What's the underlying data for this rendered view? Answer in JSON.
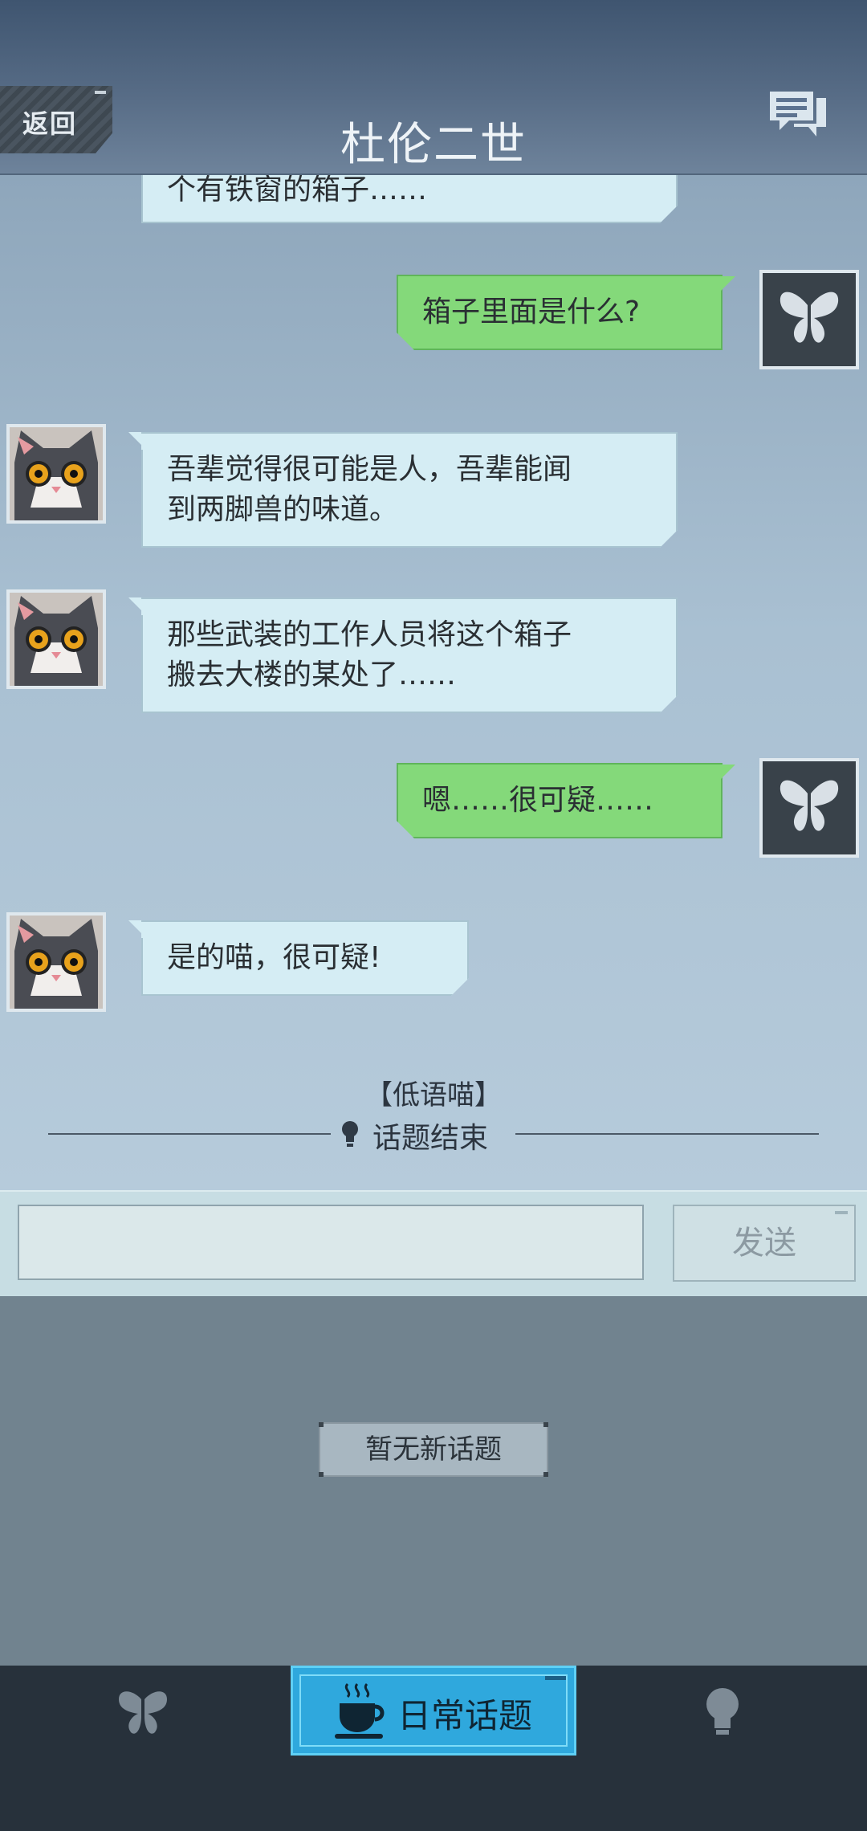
{
  "header": {
    "back_label": "返回",
    "title": "杜伦二世",
    "icons": [
      "back-button",
      "messages-icon"
    ]
  },
  "chat": {
    "messages": [
      {
        "side": "left",
        "sender": "cat",
        "text_lines": [
          "个有铁窗的箱子……"
        ]
      },
      {
        "side": "right",
        "sender": "player",
        "text_lines": [
          "箱子里面是什么?"
        ]
      },
      {
        "side": "left",
        "sender": "cat",
        "text_lines": [
          "吾辈觉得很可能是人，吾辈能闻",
          "到两脚兽的味道。"
        ]
      },
      {
        "side": "left",
        "sender": "cat",
        "text_lines": [
          "那些武装的工作人员将这个箱子",
          "搬去大楼的某处了……"
        ]
      },
      {
        "side": "right",
        "sender": "player",
        "text_lines": [
          "嗯……很可疑……"
        ]
      },
      {
        "side": "left",
        "sender": "cat",
        "text_lines": [
          "是的喵，很可疑!"
        ]
      }
    ],
    "system": {
      "source": "【低语喵】",
      "end_label": "话题结束"
    }
  },
  "input_bar": {
    "input_value": "",
    "send_label": "发送"
  },
  "topic_panel": {
    "empty_label": "暂无新话题"
  },
  "bottom_nav": {
    "items": [
      {
        "name": "butterfly-tab",
        "label": ""
      },
      {
        "name": "daily-topic-tab",
        "label": "日常话题",
        "active": true
      },
      {
        "name": "hint-tab",
        "label": ""
      }
    ]
  },
  "colors": {
    "player_bubble": "#84d97a",
    "npc_bubble": "#d5edf4",
    "active_tab": "#2fa8dd"
  }
}
